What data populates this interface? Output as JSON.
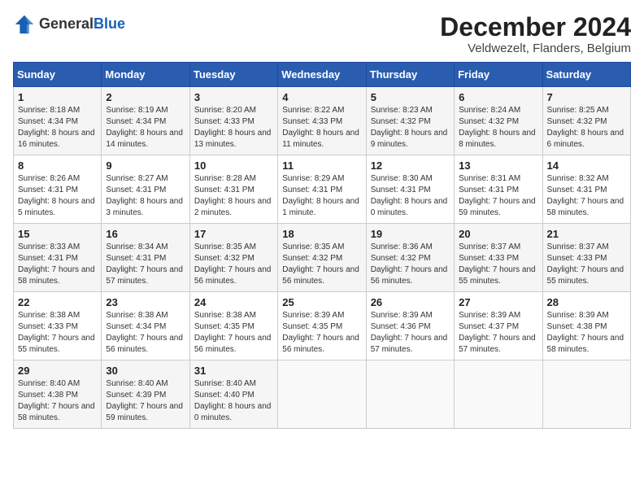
{
  "logo": {
    "general": "General",
    "blue": "Blue"
  },
  "title": {
    "month": "December 2024",
    "location": "Veldwezelt, Flanders, Belgium"
  },
  "weekdays": [
    "Sunday",
    "Monday",
    "Tuesday",
    "Wednesday",
    "Thursday",
    "Friday",
    "Saturday"
  ],
  "weeks": [
    [
      {
        "day": "1",
        "sunrise": "Sunrise: 8:18 AM",
        "sunset": "Sunset: 4:34 PM",
        "daylight": "Daylight: 8 hours and 16 minutes."
      },
      {
        "day": "2",
        "sunrise": "Sunrise: 8:19 AM",
        "sunset": "Sunset: 4:34 PM",
        "daylight": "Daylight: 8 hours and 14 minutes."
      },
      {
        "day": "3",
        "sunrise": "Sunrise: 8:20 AM",
        "sunset": "Sunset: 4:33 PM",
        "daylight": "Daylight: 8 hours and 13 minutes."
      },
      {
        "day": "4",
        "sunrise": "Sunrise: 8:22 AM",
        "sunset": "Sunset: 4:33 PM",
        "daylight": "Daylight: 8 hours and 11 minutes."
      },
      {
        "day": "5",
        "sunrise": "Sunrise: 8:23 AM",
        "sunset": "Sunset: 4:32 PM",
        "daylight": "Daylight: 8 hours and 9 minutes."
      },
      {
        "day": "6",
        "sunrise": "Sunrise: 8:24 AM",
        "sunset": "Sunset: 4:32 PM",
        "daylight": "Daylight: 8 hours and 8 minutes."
      },
      {
        "day": "7",
        "sunrise": "Sunrise: 8:25 AM",
        "sunset": "Sunset: 4:32 PM",
        "daylight": "Daylight: 8 hours and 6 minutes."
      }
    ],
    [
      {
        "day": "8",
        "sunrise": "Sunrise: 8:26 AM",
        "sunset": "Sunset: 4:31 PM",
        "daylight": "Daylight: 8 hours and 5 minutes."
      },
      {
        "day": "9",
        "sunrise": "Sunrise: 8:27 AM",
        "sunset": "Sunset: 4:31 PM",
        "daylight": "Daylight: 8 hours and 3 minutes."
      },
      {
        "day": "10",
        "sunrise": "Sunrise: 8:28 AM",
        "sunset": "Sunset: 4:31 PM",
        "daylight": "Daylight: 8 hours and 2 minutes."
      },
      {
        "day": "11",
        "sunrise": "Sunrise: 8:29 AM",
        "sunset": "Sunset: 4:31 PM",
        "daylight": "Daylight: 8 hours and 1 minute."
      },
      {
        "day": "12",
        "sunrise": "Sunrise: 8:30 AM",
        "sunset": "Sunset: 4:31 PM",
        "daylight": "Daylight: 8 hours and 0 minutes."
      },
      {
        "day": "13",
        "sunrise": "Sunrise: 8:31 AM",
        "sunset": "Sunset: 4:31 PM",
        "daylight": "Daylight: 7 hours and 59 minutes."
      },
      {
        "day": "14",
        "sunrise": "Sunrise: 8:32 AM",
        "sunset": "Sunset: 4:31 PM",
        "daylight": "Daylight: 7 hours and 58 minutes."
      }
    ],
    [
      {
        "day": "15",
        "sunrise": "Sunrise: 8:33 AM",
        "sunset": "Sunset: 4:31 PM",
        "daylight": "Daylight: 7 hours and 58 minutes."
      },
      {
        "day": "16",
        "sunrise": "Sunrise: 8:34 AM",
        "sunset": "Sunset: 4:31 PM",
        "daylight": "Daylight: 7 hours and 57 minutes."
      },
      {
        "day": "17",
        "sunrise": "Sunrise: 8:35 AM",
        "sunset": "Sunset: 4:32 PM",
        "daylight": "Daylight: 7 hours and 56 minutes."
      },
      {
        "day": "18",
        "sunrise": "Sunrise: 8:35 AM",
        "sunset": "Sunset: 4:32 PM",
        "daylight": "Daylight: 7 hours and 56 minutes."
      },
      {
        "day": "19",
        "sunrise": "Sunrise: 8:36 AM",
        "sunset": "Sunset: 4:32 PM",
        "daylight": "Daylight: 7 hours and 56 minutes."
      },
      {
        "day": "20",
        "sunrise": "Sunrise: 8:37 AM",
        "sunset": "Sunset: 4:33 PM",
        "daylight": "Daylight: 7 hours and 55 minutes."
      },
      {
        "day": "21",
        "sunrise": "Sunrise: 8:37 AM",
        "sunset": "Sunset: 4:33 PM",
        "daylight": "Daylight: 7 hours and 55 minutes."
      }
    ],
    [
      {
        "day": "22",
        "sunrise": "Sunrise: 8:38 AM",
        "sunset": "Sunset: 4:33 PM",
        "daylight": "Daylight: 7 hours and 55 minutes."
      },
      {
        "day": "23",
        "sunrise": "Sunrise: 8:38 AM",
        "sunset": "Sunset: 4:34 PM",
        "daylight": "Daylight: 7 hours and 56 minutes."
      },
      {
        "day": "24",
        "sunrise": "Sunrise: 8:38 AM",
        "sunset": "Sunset: 4:35 PM",
        "daylight": "Daylight: 7 hours and 56 minutes."
      },
      {
        "day": "25",
        "sunrise": "Sunrise: 8:39 AM",
        "sunset": "Sunset: 4:35 PM",
        "daylight": "Daylight: 7 hours and 56 minutes."
      },
      {
        "day": "26",
        "sunrise": "Sunrise: 8:39 AM",
        "sunset": "Sunset: 4:36 PM",
        "daylight": "Daylight: 7 hours and 57 minutes."
      },
      {
        "day": "27",
        "sunrise": "Sunrise: 8:39 AM",
        "sunset": "Sunset: 4:37 PM",
        "daylight": "Daylight: 7 hours and 57 minutes."
      },
      {
        "day": "28",
        "sunrise": "Sunrise: 8:39 AM",
        "sunset": "Sunset: 4:38 PM",
        "daylight": "Daylight: 7 hours and 58 minutes."
      }
    ],
    [
      {
        "day": "29",
        "sunrise": "Sunrise: 8:40 AM",
        "sunset": "Sunset: 4:38 PM",
        "daylight": "Daylight: 7 hours and 58 minutes."
      },
      {
        "day": "30",
        "sunrise": "Sunrise: 8:40 AM",
        "sunset": "Sunset: 4:39 PM",
        "daylight": "Daylight: 7 hours and 59 minutes."
      },
      {
        "day": "31",
        "sunrise": "Sunrise: 8:40 AM",
        "sunset": "Sunset: 4:40 PM",
        "daylight": "Daylight: 8 hours and 0 minutes."
      },
      {
        "day": "",
        "sunrise": "",
        "sunset": "",
        "daylight": ""
      },
      {
        "day": "",
        "sunrise": "",
        "sunset": "",
        "daylight": ""
      },
      {
        "day": "",
        "sunrise": "",
        "sunset": "",
        "daylight": ""
      },
      {
        "day": "",
        "sunrise": "",
        "sunset": "",
        "daylight": ""
      }
    ]
  ]
}
